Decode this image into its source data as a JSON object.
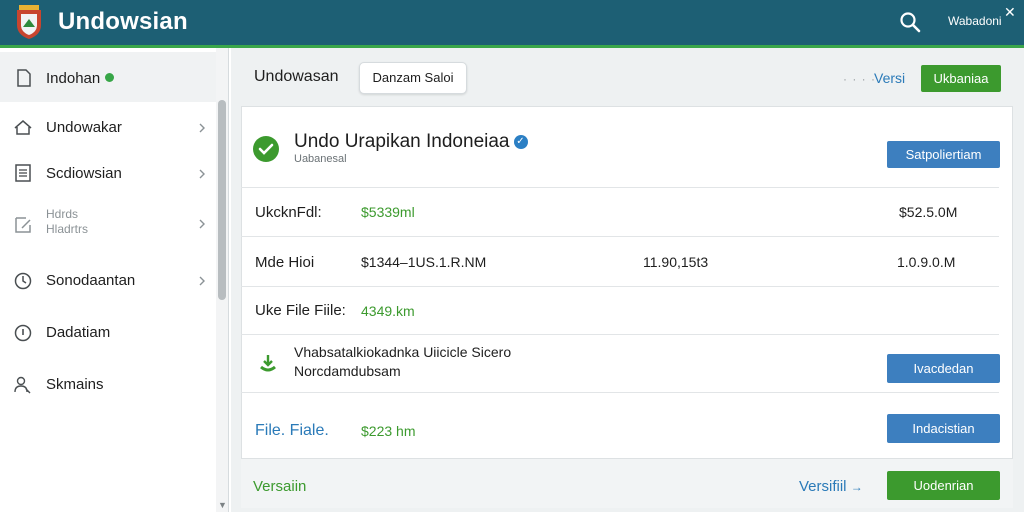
{
  "app": {
    "title": "Undowsian",
    "user": "Wabadoni"
  },
  "sidebar": {
    "items": [
      {
        "label": "Indohan",
        "icon": "document-icon"
      },
      {
        "label": "Undowakar",
        "icon": "home-icon"
      },
      {
        "label": "Scdiowsian",
        "icon": "list-icon"
      },
      {
        "label": "Hdrds",
        "sublabel": "Hladrtrs",
        "icon": "edit-icon"
      },
      {
        "label": "Sonodaantan",
        "icon": "clock-icon"
      },
      {
        "label": "Dadatiam",
        "icon": "info-icon"
      },
      {
        "label": "Skmains",
        "icon": "users-icon"
      }
    ]
  },
  "toolbar": {
    "title": "Undowasan",
    "tab": "Danzam Saloi",
    "link": "Versi",
    "button": "Ukbaniaa"
  },
  "card": {
    "title": "Undo Urapikan Indoneiaa",
    "subtitle": "Uabanesal",
    "action": "Satpoliertiam",
    "rows": [
      {
        "label": "UkcknFdl:",
        "value": "$5339ml",
        "right": "$52.5.0M"
      },
      {
        "label": "Mde Hioi",
        "value": "$1344–1US.1.R.NM",
        "mid": "11.90,15t3",
        "right": "1.0.9.0.M"
      },
      {
        "label": "Uke File Fiile:",
        "value": "4349.km"
      }
    ],
    "upload": {
      "title": "Vhabsatalkiokadnka Uiicicle Sicero",
      "subtitle": "Norcdamdubsam",
      "action": "Ivacdedan"
    },
    "file": {
      "label": "File. Fiale.",
      "value": "$223 hm",
      "action": "Indacistian"
    },
    "footer": {
      "label": "Versaiin",
      "link": "Versifiil",
      "action": "Uodenrian"
    }
  }
}
